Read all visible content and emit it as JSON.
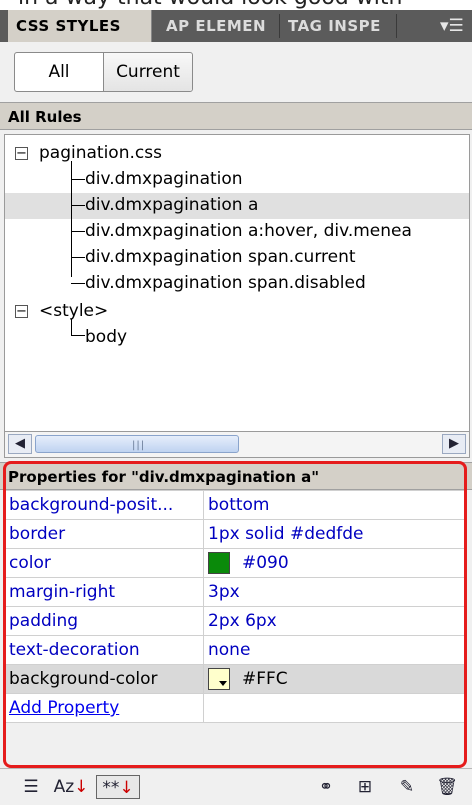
{
  "top_strip_text": "in a way that would look good with",
  "tabs": [
    {
      "label": "CSS STYLES"
    },
    {
      "label": "AP ELEMEN"
    },
    {
      "label": "TAG INSPE"
    }
  ],
  "mode": {
    "all_label": "All",
    "current_label": "Current"
  },
  "all_rules_heading": "All Rules",
  "tree": {
    "sheet1": {
      "label": "pagination.css",
      "expander": "−",
      "rules": [
        "div.dmxpagination",
        "div.dmxpagination a",
        "div.dmxpagination a:hover, div.menea",
        "div.dmxpagination span.current",
        "div.dmxpagination span.disabled"
      ]
    },
    "sheet2": {
      "label": "<style>",
      "expander": "−",
      "rules": [
        "body"
      ]
    }
  },
  "properties": {
    "heading": "Properties for \"div.dmxpagination a\"",
    "rows": [
      {
        "name": "background-posit...",
        "value": "bottom"
      },
      {
        "name": "border",
        "value": "1px solid #dedfde"
      },
      {
        "name": "color",
        "value": "#090",
        "swatch": "#0a8a0a"
      },
      {
        "name": "margin-right",
        "value": "3px"
      },
      {
        "name": "padding",
        "value": "2px 6px"
      },
      {
        "name": "text-decoration",
        "value": "none"
      },
      {
        "name": "background-color",
        "value": "#FFC",
        "swatch": "#ffffcc"
      }
    ],
    "add_label": "Add Property"
  },
  "bottom_tools": {
    "category_view_icon": "category-list-icon",
    "az_label": "Az",
    "set_only_label": "**",
    "attach_icon": "link-icon",
    "new_rule_icon": "new-rule-icon",
    "edit_icon": "pencil-icon",
    "delete_icon": "trash-icon"
  },
  "colors": {
    "highlight": "#e51c1c",
    "tab_bar": "#5b5b5b",
    "link": "#0000c0"
  }
}
